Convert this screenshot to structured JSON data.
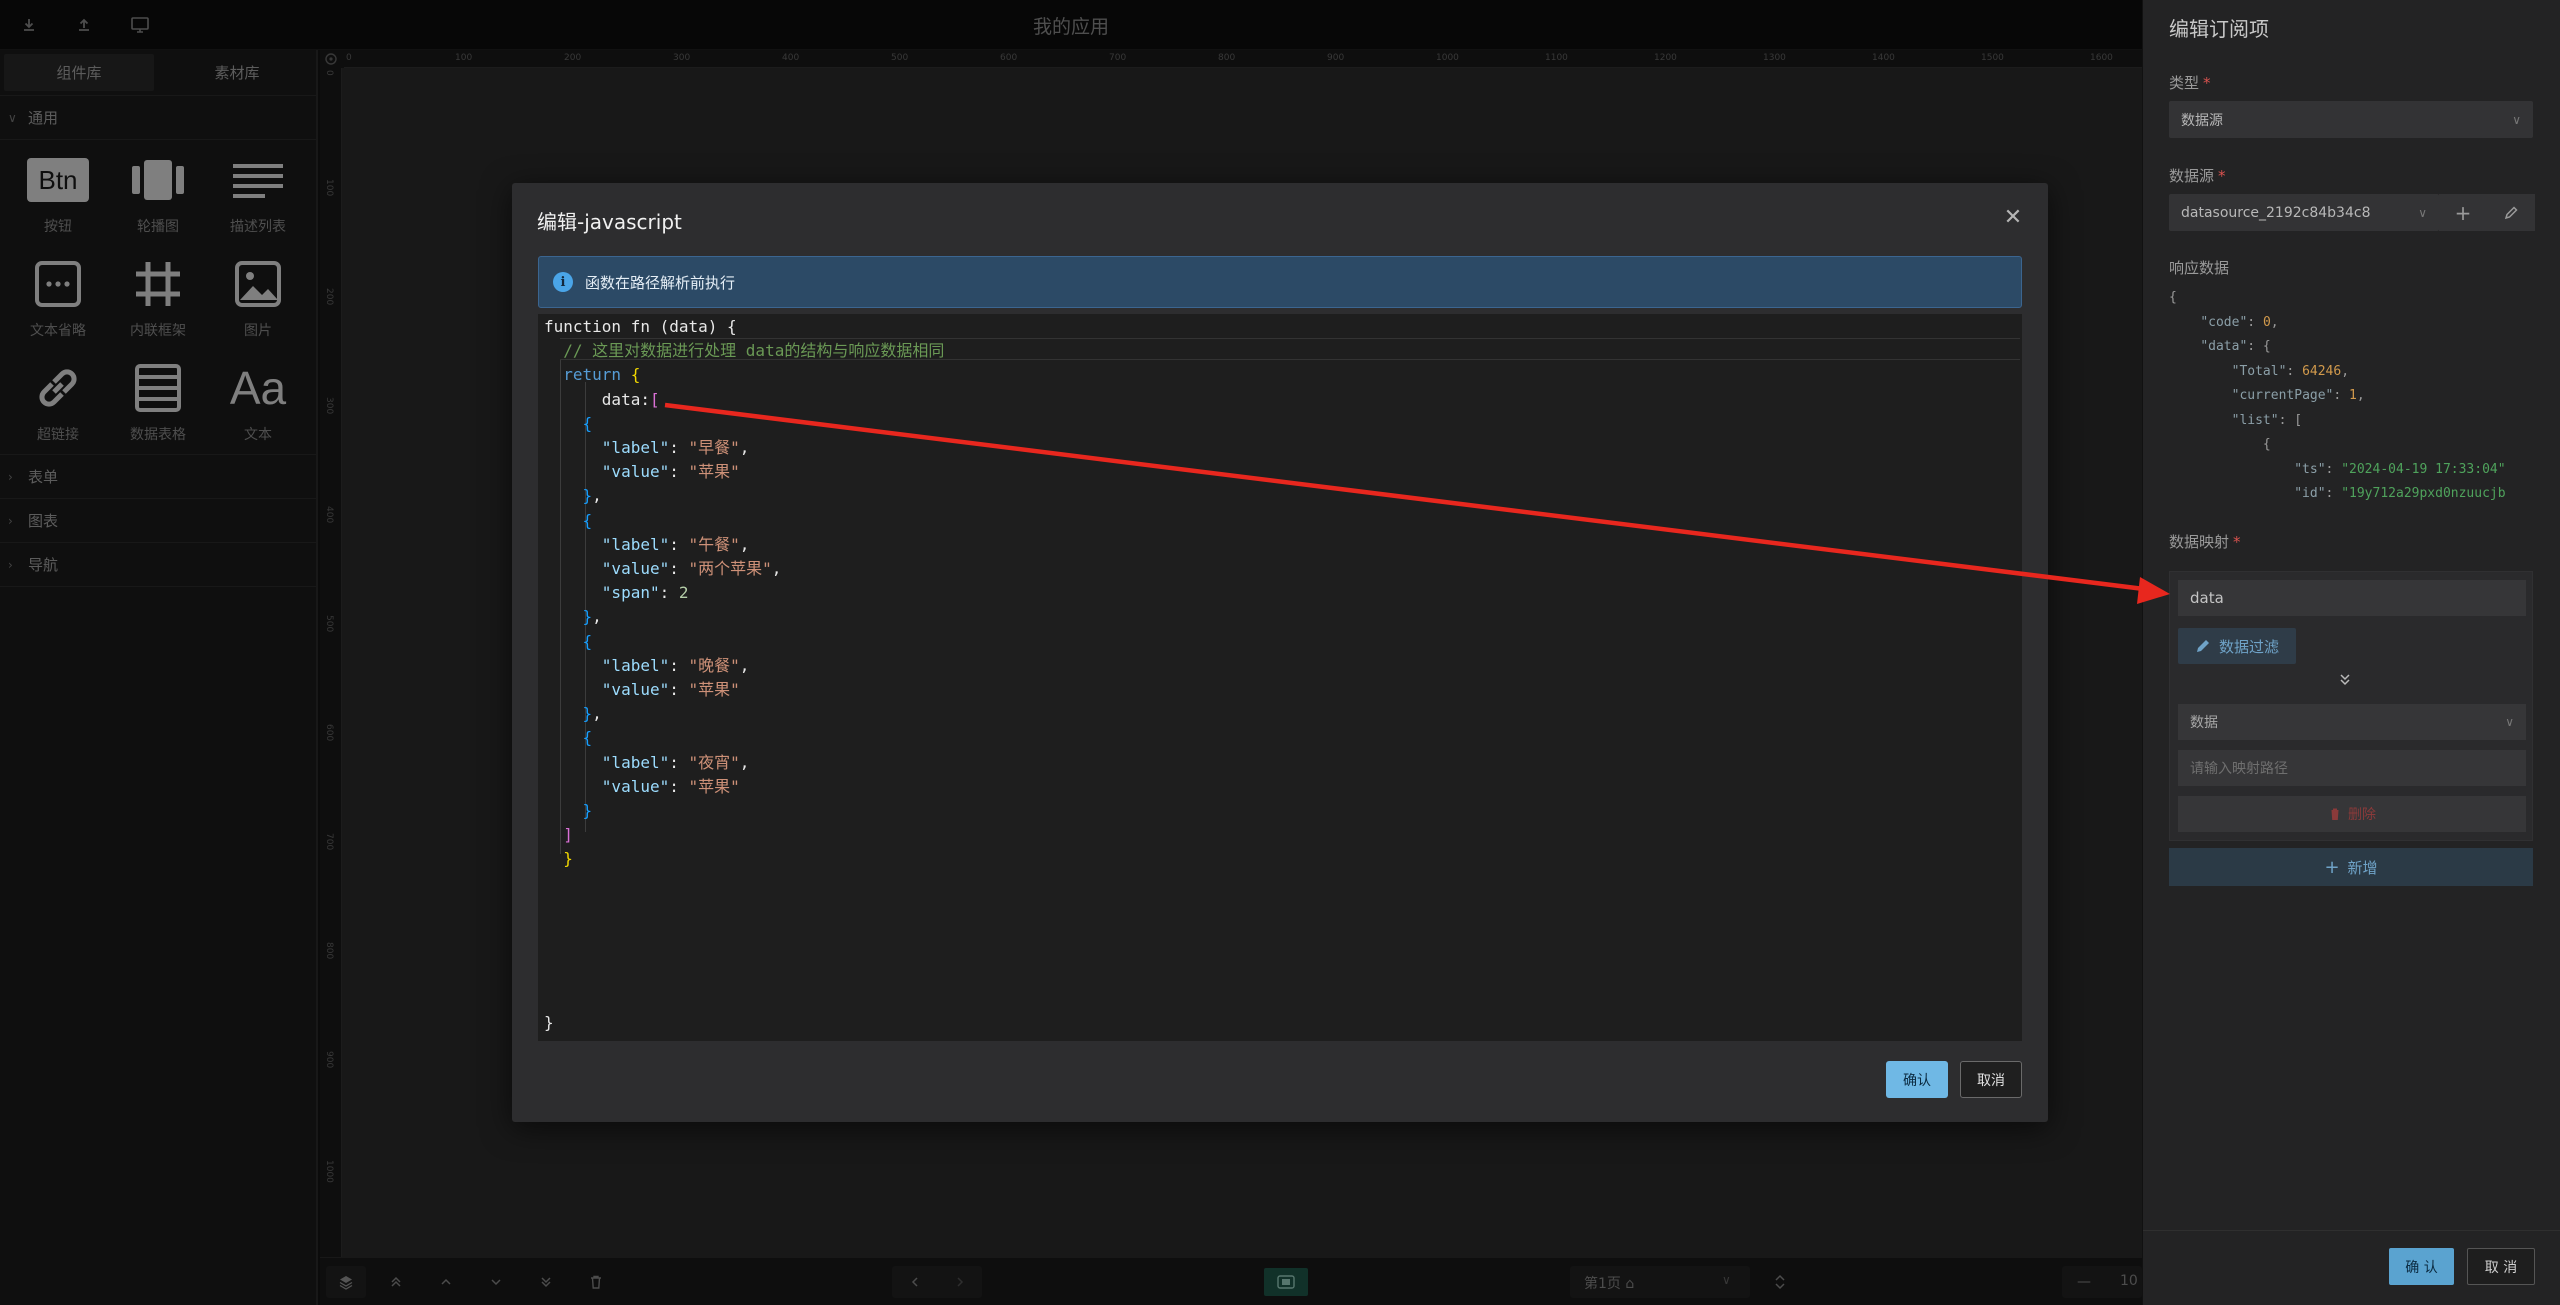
{
  "topbar": {
    "title": "我的应用",
    "icons": [
      "download-icon",
      "upload-icon",
      "monitor-icon"
    ]
  },
  "left_panel": {
    "tabs": [
      "组件库",
      "素材库"
    ],
    "sections": [
      {
        "label": "通用",
        "expanded": true
      },
      {
        "label": "表单",
        "expanded": false
      },
      {
        "label": "图表",
        "expanded": false
      },
      {
        "label": "导航",
        "expanded": false
      }
    ],
    "components": [
      {
        "label": "按钮",
        "icon": "button-icon"
      },
      {
        "label": "轮播图",
        "icon": "carousel-icon"
      },
      {
        "label": "描述列表",
        "icon": "description-list-icon"
      },
      {
        "label": "文本省略",
        "icon": "text-ellipsis-icon"
      },
      {
        "label": "内联框架",
        "icon": "iframe-icon"
      },
      {
        "label": "图片",
        "icon": "image-icon"
      },
      {
        "label": "超链接",
        "icon": "link-icon"
      },
      {
        "label": "数据表格",
        "icon": "table-icon"
      },
      {
        "label": "文本",
        "icon": "text-icon"
      }
    ],
    "btn_glyph": "Btn",
    "text_glyph": "Aa"
  },
  "canvas": {
    "ruler_marks": [
      "0",
      "100",
      "200",
      "300",
      "400",
      "500",
      "600",
      "700",
      "800",
      "900",
      "1000",
      "1100",
      "1200",
      "1300",
      "1400",
      "1500",
      "1600"
    ]
  },
  "bottombar": {
    "page_label": "第1页",
    "zoom_value": "10"
  },
  "modal": {
    "title": "编辑-javascript",
    "alert_text": "函数在路径解析前执行",
    "code_lines": [
      "function fn (data) {",
      "  // 这里对数据进行处理 data的结构与响应数据相同",
      "  return {",
      "      data:[",
      "    {",
      "      \"label\": \"早餐\",",
      "      \"value\": \"苹果\"",
      "    },",
      "    {",
      "      \"label\": \"午餐\",",
      "      \"value\": \"两个苹果\",",
      "      \"span\": 2",
      "    },",
      "    {",
      "      \"label\": \"晚餐\",",
      "      \"value\": \"苹果\"",
      "    },",
      "    {",
      "      \"label\": \"夜宵\",",
      "      \"value\": \"苹果\"",
      "    }",
      "  ]",
      "  }",
      "}"
    ],
    "confirm_label": "确认",
    "cancel_label": "取消"
  },
  "drawer": {
    "title": "编辑订阅项",
    "type_label": "类型",
    "type_value": "数据源",
    "datasource_label": "数据源",
    "datasource_value": "datasource_2192c84b34c8",
    "response_label": "响应数据",
    "response_json": [
      "{",
      "    \"code\": 0,",
      "    \"data\": {",
      "        \"Total\": 64246,",
      "        \"currentPage\": 1,",
      "        \"list\": [",
      "            {",
      "                \"ts\": \"2024-04-19 17:33:04\"",
      "                \"id\": \"19y712a29pxd0nzuucjb"
    ],
    "mapping_label": "数据映射",
    "mapping_input_value": "data",
    "filter_label": "数据过滤",
    "mapping_select_value": "数据",
    "mapping_path_placeholder": "请输入映射路径",
    "delete_label": "删除",
    "add_label": "新增",
    "ok_label": "确 认",
    "cancel_label": "取 消"
  },
  "colors": {
    "annotation_arrow": "#e8271e",
    "primary": "#6fb8e5",
    "alert_bg": "#2c4a66"
  }
}
